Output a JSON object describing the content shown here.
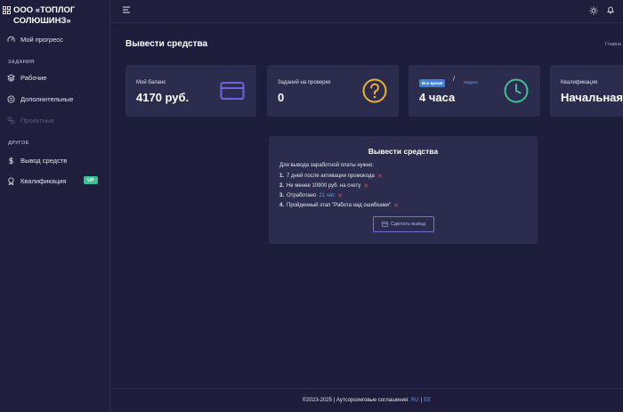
{
  "sidebar": {
    "brand_line1": "ООО «ТОПЛОГ",
    "brand_line2": "СОЛЮШИНЗ»",
    "progress": "Мой прогресс",
    "section_tasks": "ЗАДАНИЯ",
    "work": "Рабочие",
    "extra": "Дополнительные",
    "projects": "Проектные",
    "section_other": "ДРУГОЕ",
    "withdraw": "Вывод средств",
    "qualification": "Квалификация",
    "up_badge": "UP"
  },
  "page": {
    "title": "Вывести средства",
    "breadcrumb": "Главна"
  },
  "cards": {
    "balance_label": "Мой баланс",
    "balance_value": "4170 руб.",
    "review_label": "Заданий на проверке",
    "review_value": "0",
    "time_all": "Все время",
    "time_sep": "/",
    "time_week": "Неделя",
    "time_value": "4 часа",
    "qual_label": "Квалификация",
    "qual_value": "Начальная"
  },
  "panel": {
    "title": "Вывести средства",
    "intro": "Для вывода заработной платы нужно:",
    "req1_num": "1.",
    "req1_text": "7 дней после активации промокода",
    "req2_num": "2.",
    "req2_text": "Не менее 10900 руб. на счету",
    "req3_num": "3.",
    "req3_text": "Отработано",
    "req3_link": "21 час",
    "req4_num": "4.",
    "req4_text": "Пройденный этап \"Работа над ошибками\"",
    "x_mark": "✕",
    "button": "Сделать вывод"
  },
  "footer": {
    "text": "©2023-2025 | Аутсорсинговые соглашения:",
    "ru": "RU",
    "sep": "|",
    "ee": "EE"
  },
  "colors": {
    "background": "#1e1e3c",
    "card": "#2c2c4e",
    "accent_purple": "#6f63e0",
    "accent_yellow": "#f0b429",
    "accent_teal": "#3fbf94",
    "link_blue": "#6d92e6",
    "error_red": "#e14a5a"
  },
  "icons": {
    "brand": "grid-icon",
    "progress": "gauge-icon",
    "work": "layers-icon",
    "extra": "list-icon",
    "projects": "project-icon",
    "withdraw": "dollar-icon",
    "qualification": "award-icon",
    "menu": "hamburger-icon",
    "theme": "sun-icon",
    "notifications": "bell-icon",
    "balance": "credit-card-icon",
    "review": "question-icon",
    "time": "clock-icon",
    "button": "wallet-icon"
  }
}
